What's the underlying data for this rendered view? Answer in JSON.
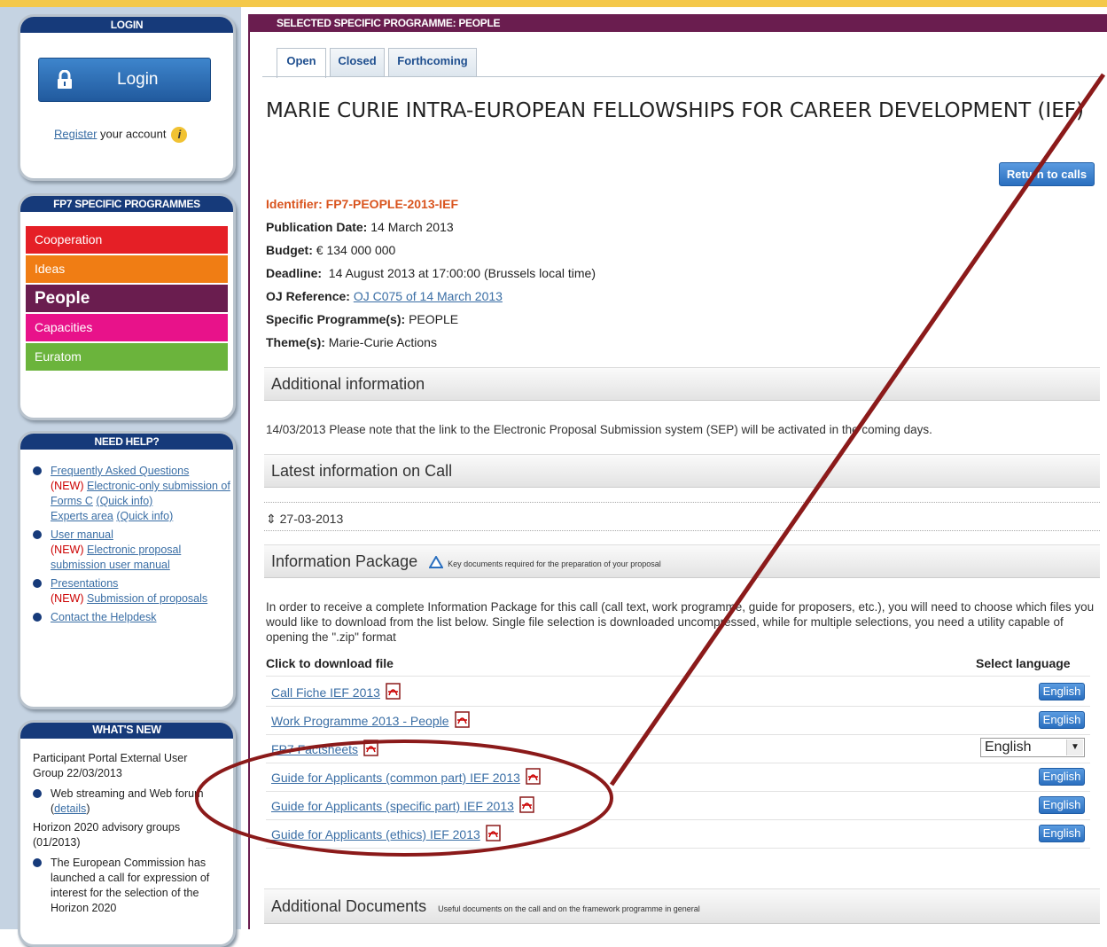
{
  "sidebar": {
    "login": {
      "title": "LOGIN",
      "button_label": "Login",
      "register_link": "Register",
      "register_text": " your account"
    },
    "programmes": {
      "title": "FP7 SPECIFIC PROGRAMMES",
      "items": [
        {
          "label": "Cooperation",
          "color": "#e51f26"
        },
        {
          "label": "Ideas",
          "color": "#f07d14"
        },
        {
          "label": "People",
          "color": "#6a1d4f"
        },
        {
          "label": "Capacities",
          "color": "#e8128a"
        },
        {
          "label": "Euratom",
          "color": "#6bb43c"
        }
      ]
    },
    "help": {
      "title": "NEED HELP?",
      "faq": "Frequently Asked Questions",
      "new1": "(NEW)",
      "faq_sub1": "Electronic-only submission of Forms C",
      "quick1": "(Quick info)",
      "experts": "Experts area",
      "quick2": "(Quick info)",
      "user_manual": "User manual",
      "new2": "(NEW)",
      "um_sub": "Electronic proposal submission user manual",
      "presentations": "Presentations",
      "new3": "(NEW)",
      "pres_sub": "Submission of proposals",
      "contact": "Contact the Helpdesk"
    },
    "whatsnew": {
      "title": "WHAT'S NEW",
      "item1": "Participant Portal External User Group 22/03/2013",
      "item2_text": "Web streaming and Web forum",
      "item2_link": "details",
      "item3": "Horizon 2020 advisory groups (01/2013)",
      "item4": "The European Commission has launched a call for expression of interest for the selection of the Horizon 2020"
    }
  },
  "main": {
    "header": "SELECTED SPECIFIC PROGRAMME: PEOPLE",
    "tabs": [
      {
        "label": "Open"
      },
      {
        "label": "Closed"
      },
      {
        "label": "Forthcoming"
      }
    ],
    "title": "MARIE CURIE INTRA-EUROPEAN FELLOWSHIPS FOR CAREER DEVELOPMENT (IEF)",
    "return_button": "Return to calls",
    "identifier_label": "Identifier: FP7-PEOPLE-2013-IEF",
    "publication_label": "Publication Date:",
    "publication_value": "14 March 2013",
    "budget_label": "Budget:",
    "budget_value": "€ 134 000 000",
    "deadline_label": "Deadline:",
    "deadline_value": "14 August 2013 at 17:00:00 (Brussels local time)",
    "oj_label": "OJ Reference:",
    "oj_value": "OJ C075 of 14 March 2013",
    "sp_label": "Specific Programme(s):",
    "sp_value": "PEOPLE",
    "theme_label": "Theme(s):",
    "theme_value": "Marie-Curie Actions",
    "additional_info_title": "Additional information",
    "additional_info_text": "14/03/2013 Please note that the link to the Electronic Proposal Submission system (SEP) will be activated in the coming days.",
    "latest_title": "Latest information on Call",
    "latest_date": "27-03-2013",
    "package_title": "Information Package",
    "package_note": "Key documents required for the preparation of your proposal",
    "package_text": "In order to receive a complete Information Package for this call (call text, work programme, guide for proposers, etc.), you will need to choose which files you would like to download from the list below. Single file selection is downloaded uncompressed, while for multiple selections, you need a utility capable of opening the \".zip\" format",
    "click_header": "Click to download file",
    "lang_header": "Select language",
    "files": [
      {
        "label": "Call Fiche IEF 2013",
        "lang": "English"
      },
      {
        "label": "Work Programme 2013 - People",
        "lang": "English"
      },
      {
        "label": "FP7 Factsheets",
        "lang": "English"
      },
      {
        "label": "Guide for Applicants (common part) IEF 2013",
        "lang": "English"
      },
      {
        "label": "Guide for Applicants (specific part) IEF 2013",
        "lang": "English"
      },
      {
        "label": "Guide for Applicants (ethics) IEF 2013",
        "lang": "English"
      }
    ],
    "additional_docs_title": "Additional Documents",
    "additional_docs_note": "Useful documents on the call and on the framework programme in general"
  },
  "annotation_color": "#8b1a1a"
}
